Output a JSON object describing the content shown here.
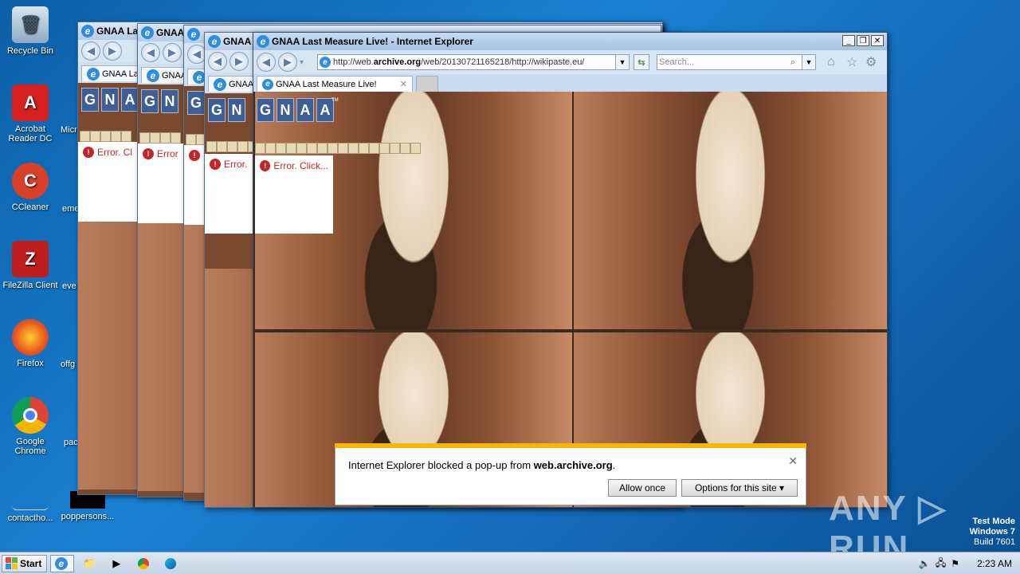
{
  "desktop": {
    "icons": [
      {
        "label": "Recycle Bin",
        "icon": "recycle-bin-icon"
      },
      {
        "label": "Acrobat Reader DC",
        "icon": "acrobat-icon"
      },
      {
        "label": "CCleaner",
        "icon": "ccleaner-icon"
      },
      {
        "label": "FileZilla Client",
        "icon": "filezilla-icon"
      },
      {
        "label": "Firefox",
        "icon": "firefox-icon"
      },
      {
        "label": "Google Chrome",
        "icon": "chrome-icon"
      },
      {
        "label": "contactho...",
        "icon": "file-icon"
      },
      {
        "label": "poppersons...",
        "icon": "file-icon"
      }
    ],
    "partial_labels": [
      "Micr",
      "eme",
      "eve",
      "offg",
      "pac"
    ]
  },
  "background_windows": {
    "title": "GNAA Last Measure Live!",
    "title_short": "GNAA Las",
    "title_short2": "GNAA",
    "title_short3": "GNAA L",
    "tab_short": "GNAA Las",
    "tab_short2": "GNAA",
    "error_short": "Error. Cl",
    "error_short2": "Error",
    "error_short3": "Error."
  },
  "main_window": {
    "title": "GNAA Last Measure Live! - Internet Explorer",
    "address_prefix": "http://web.",
    "address_domain": "archive.org",
    "address_suffix": "/web/20130721165218/http://wikipaste.eu/",
    "search_placeholder": "Search...",
    "tab_label": "GNAA Last Measure Live!",
    "logo_letters": [
      "G",
      "N",
      "A",
      "A"
    ],
    "tm": "TM",
    "error_text": "Error. Click..."
  },
  "notification": {
    "message_prefix": "Internet Explorer blocked a pop-up from ",
    "message_domain": "web.archive.org",
    "message_suffix": ".",
    "allow_label": "Allow once",
    "options_label": "Options for this site ▾"
  },
  "taskbar": {
    "start_label": "Start",
    "clock": "2:23 AM"
  },
  "watermark": {
    "line1": "Test Mode",
    "line2": "Windows 7",
    "line3": "Build 7601",
    "brand": "ANY ▷ RUN"
  }
}
